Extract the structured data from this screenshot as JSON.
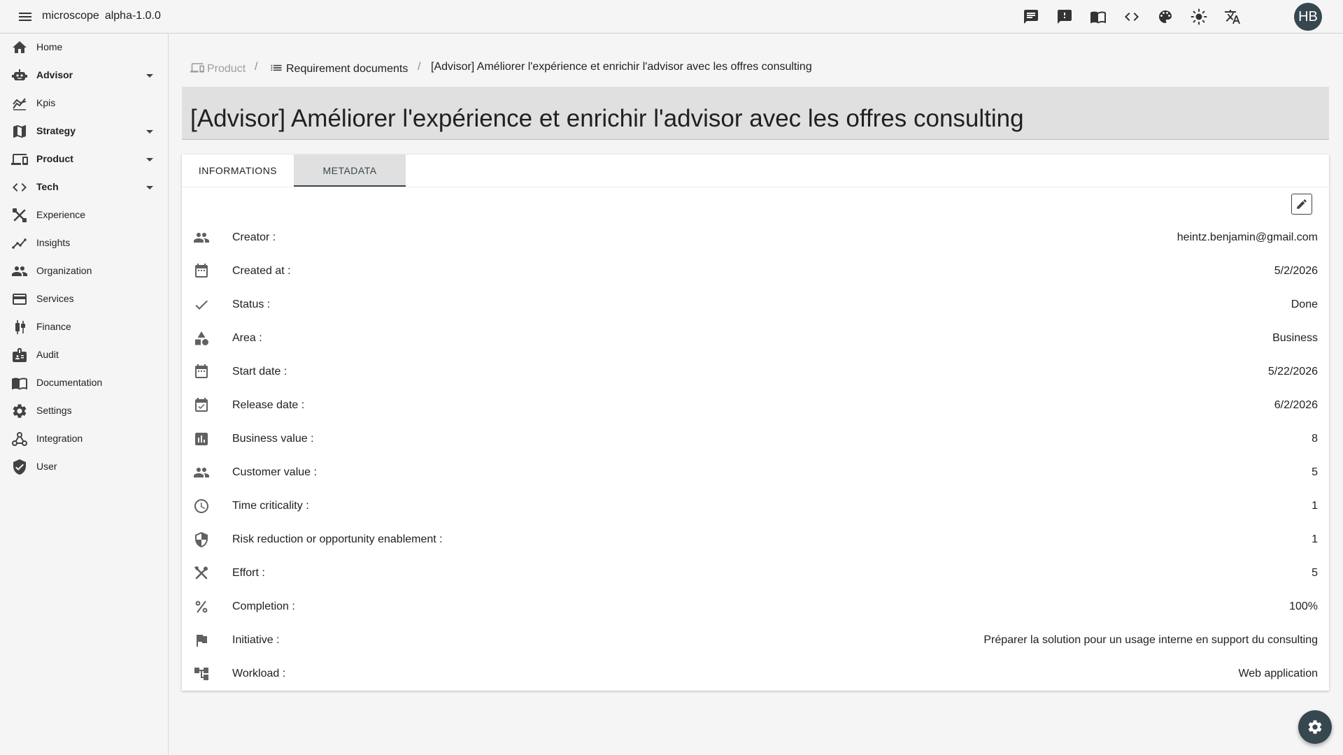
{
  "app": {
    "name": "microscope",
    "version": "alpha-1.0.0"
  },
  "topbar": {
    "icons": [
      "chat-icon",
      "feedback-icon",
      "docs-book-icon",
      "code-icon",
      "palette-icon",
      "brightness-icon",
      "translate-icon"
    ],
    "avatar_initials": "HB"
  },
  "sidebar": {
    "items": [
      {
        "label": "Home",
        "icon": "home-icon",
        "expandable": false,
        "bold": false
      },
      {
        "label": "Advisor",
        "icon": "robot-icon",
        "expandable": true,
        "bold": true
      },
      {
        "label": "Kpis",
        "icon": "kpi-chart-icon",
        "expandable": false,
        "bold": false
      },
      {
        "label": "Strategy",
        "icon": "map-icon",
        "expandable": true,
        "bold": true
      },
      {
        "label": "Product",
        "icon": "devices-icon",
        "expandable": true,
        "bold": true
      },
      {
        "label": "Tech",
        "icon": "code-icon",
        "expandable": true,
        "bold": true
      },
      {
        "label": "Experience",
        "icon": "design-tools-icon",
        "expandable": false,
        "bold": false
      },
      {
        "label": "Insights",
        "icon": "insights-icon",
        "expandable": false,
        "bold": false
      },
      {
        "label": "Organization",
        "icon": "people-icon",
        "expandable": false,
        "bold": false
      },
      {
        "label": "Services",
        "icon": "card-icon",
        "expandable": false,
        "bold": false
      },
      {
        "label": "Finance",
        "icon": "candlestick-icon",
        "expandable": false,
        "bold": false
      },
      {
        "label": "Audit",
        "icon": "badge-icon",
        "expandable": false,
        "bold": false
      },
      {
        "label": "Documentation",
        "icon": "menu-book-icon",
        "expandable": false,
        "bold": false
      },
      {
        "label": "Settings",
        "icon": "gear-icon",
        "expandable": false,
        "bold": false
      },
      {
        "label": "Integration",
        "icon": "webhook-icon",
        "expandable": false,
        "bold": false
      },
      {
        "label": "User",
        "icon": "verified-user-icon",
        "expandable": false,
        "bold": false
      }
    ]
  },
  "breadcrumb": {
    "items": [
      {
        "label": "Product",
        "icon": "devices-icon",
        "muted": true
      },
      {
        "label": "Requirement documents",
        "icon": "list-icon",
        "muted": false
      },
      {
        "label": "[Advisor] Améliorer l'expérience et enrichir l'advisor avec les offres consulting",
        "icon": null,
        "muted": false
      }
    ],
    "separator": "/"
  },
  "page": {
    "title": "[Advisor] Améliorer l'expérience et enrichir l'advisor avec les offres consulting"
  },
  "tabs": {
    "informations": "INFORMATIONS",
    "metadata": "METADATA",
    "active": "metadata"
  },
  "metadata": {
    "rows": [
      {
        "label": "Creator :",
        "value": "heintz.benjamin@gmail.com",
        "icon": "people-icon"
      },
      {
        "label": "Created at :",
        "value": "5/2/2026",
        "icon": "calendar-icon"
      },
      {
        "label": "Status :",
        "value": "Done",
        "icon": "check-icon"
      },
      {
        "label": "Area :",
        "value": "Business",
        "icon": "category-icon"
      },
      {
        "label": "Start date :",
        "value": "5/22/2026",
        "icon": "calendar-icon"
      },
      {
        "label": "Release date :",
        "value": "6/2/2026",
        "icon": "event-available-icon"
      },
      {
        "label": "Business value :",
        "value": "8",
        "icon": "analytics-icon"
      },
      {
        "label": "Customer value :",
        "value": "5",
        "icon": "people-icon"
      },
      {
        "label": "Time criticality :",
        "value": "1",
        "icon": "clock-icon"
      },
      {
        "label": "Risk reduction or opportunity enablement :",
        "value": "1",
        "icon": "shield-icon"
      },
      {
        "label": "Effort :",
        "value": "5",
        "icon": "tools-icon"
      },
      {
        "label": "Completion :",
        "value": "100%",
        "icon": "percent-icon"
      },
      {
        "label": "Initiative :",
        "value": "Préparer la solution pour un usage interne en support du consulting",
        "icon": "flag-icon"
      },
      {
        "label": "Workload :",
        "value": "Web application",
        "icon": "account-tree-icon"
      }
    ]
  },
  "colors": {
    "primary": "#37474f",
    "background": "#f5f5f5",
    "header_block": "#e0e0e0"
  }
}
